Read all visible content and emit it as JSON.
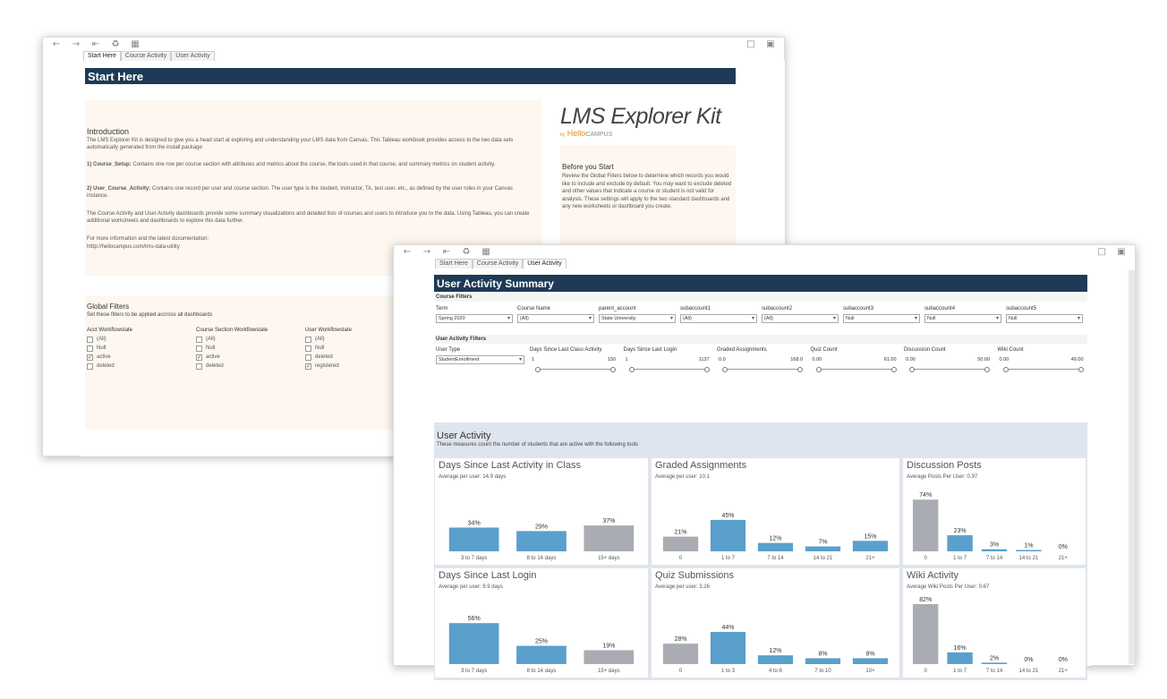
{
  "win1": {
    "tabs": [
      "Start Here",
      "Course Activity",
      "User Activity"
    ],
    "banner": "Start Here",
    "intro": {
      "heading": "Introduction",
      "p1": "The LMS Explorer Kit is designed to give you a head start at exploring and understanding your LMS data from Canvas.  This Tableau workbook provides access to the two data sets automatically generated from the install package:",
      "p2_bold": "1) Course_Setup:",
      "p2": " Contains one row per course section with attributes and metrics about the course, the tools used  in that course, and summary metrics on student activity.",
      "p3_bold": "2) User_Course_Activity:",
      "p3": " Contains one record per user and course section.  The user type is the student, instructor, TA, test user, etc., as defined by the user roles in your Canvas instance.",
      "p4": "The Course Activity and User Activity dashboards provide some summary visualizations and detailed lists of courses and users to introduce you to the data.  Using Tableau, you can create additional worksheets and dashboards to explore this data further.",
      "p5": "For more information and the latest documentation:",
      "p6": "htttp://heliocampus.com/lms-data-utility"
    },
    "logo": {
      "main": "LMS Explorer Kit",
      "by": "by",
      "brand_a": "Hello",
      "brand_b": "CAMPUS"
    },
    "before": {
      "heading": "Before you Start",
      "text": "Review the Global Filters below to determine which records you would like to include and exclude by default.  You may want to exclude deleted and other values that indicate a course or student is not valid for analysis.  These settings will apply to the two standard dashboards and any new worksheets or dashboard you create."
    },
    "global_filters": {
      "heading": "Global Filters",
      "sub": "Set these filters to be applied accross all dashboards",
      "groups": [
        {
          "title": "Acct Workflowstate",
          "items": [
            {
              "label": "(All)",
              "checked": false
            },
            {
              "label": "Null",
              "checked": false
            },
            {
              "label": "active",
              "checked": true
            },
            {
              "label": "deleted",
              "checked": false
            }
          ]
        },
        {
          "title": "Course Section Workflowstate",
          "items": [
            {
              "label": "(All)",
              "checked": false
            },
            {
              "label": "Null",
              "checked": false
            },
            {
              "label": "active",
              "checked": true
            },
            {
              "label": "deleted",
              "checked": false
            }
          ]
        },
        {
          "title": "User Workflowstate",
          "items": [
            {
              "label": "(All)",
              "checked": false
            },
            {
              "label": "Null",
              "checked": false
            },
            {
              "label": "deleted",
              "checked": false
            },
            {
              "label": "registered",
              "checked": true
            }
          ]
        }
      ]
    }
  },
  "win2": {
    "tabs": [
      "Start Here",
      "Course Activity",
      "User Activity"
    ],
    "banner": "User Activity Summary",
    "course_filters": {
      "label": "Course Filters",
      "fields": [
        {
          "label": "Term",
          "value": "Spring 2020"
        },
        {
          "label": "Course Name",
          "value": "(All)"
        },
        {
          "label": "parent_account",
          "value": "State University"
        },
        {
          "label": "subaccount1",
          "value": "(All)"
        },
        {
          "label": "subaccount2",
          "value": "(All)"
        },
        {
          "label": "subaccount3",
          "value": "Null"
        },
        {
          "label": "subaccount4",
          "value": "Null"
        },
        {
          "label": "subaccount5",
          "value": "Null"
        }
      ]
    },
    "user_filters": {
      "label": "User Activity Filters",
      "user_type": {
        "label": "User Type",
        "value": "StudentEnrollment"
      },
      "sliders": [
        {
          "label": "Days Since Last Class Activity",
          "min": "1",
          "max": "150"
        },
        {
          "label": "Days Since Last Login",
          "min": "1",
          "max": "1137"
        },
        {
          "label": "Graded Assignments",
          "min": "0.0",
          "max": "168.0"
        },
        {
          "label": "Quiz Count",
          "min": "0.00",
          "max": "61.00"
        },
        {
          "label": "Discussion Count",
          "min": "0.00",
          "max": "50.00"
        },
        {
          "label": "Wiki Count",
          "min": "0.00",
          "max": "49.00"
        }
      ]
    },
    "user_activity": {
      "heading": "User Activity",
      "sub": "These measures count the number of students that are active with the following tools"
    }
  },
  "chart_data": [
    {
      "type": "bar",
      "title": "Days Since Last Activity in Class",
      "subtitle": "Average per user: 14.9 days",
      "categories": [
        "3 to 7 days",
        "8 to 14 days",
        "15+ days"
      ],
      "values": [
        34,
        29,
        37
      ],
      "labels": [
        "34%",
        "29%",
        "37%"
      ],
      "colors": [
        "#5b9fcc",
        "#5b9fcc",
        "#a9adb3"
      ]
    },
    {
      "type": "bar",
      "title": "Graded Assignments",
      "subtitle": "Average per user: 10.1",
      "categories": [
        "0",
        "1 to 7",
        "7 to 14",
        "14 to 21",
        "21+"
      ],
      "values": [
        21,
        45,
        12,
        7,
        15
      ],
      "labels": [
        "21%",
        "45%",
        "12%",
        "7%",
        "15%"
      ],
      "colors": [
        "#a9adb3",
        "#5b9fcc",
        "#5b9fcc",
        "#5b9fcc",
        "#5b9fcc"
      ]
    },
    {
      "type": "bar",
      "title": "Discussion Posts",
      "subtitle": "Average Posts Per User: 0.97",
      "categories": [
        "0",
        "1 to 7",
        "7 to 14",
        "14 to 21",
        "21+"
      ],
      "values": [
        74,
        23,
        3,
        1,
        0
      ],
      "labels": [
        "74%",
        "23%",
        "3%",
        "1%",
        "0%"
      ],
      "colors": [
        "#a9adb3",
        "#5b9fcc",
        "#5b9fcc",
        "#5b9fcc",
        "#5b9fcc"
      ]
    },
    {
      "type": "bar",
      "title": "Days Since Last Login",
      "subtitle": "Average per user: 9.9 days",
      "categories": [
        "3 to 7 days",
        "8 to 14 days",
        "15+ days"
      ],
      "values": [
        56,
        25,
        19
      ],
      "labels": [
        "56%",
        "25%",
        "19%"
      ],
      "colors": [
        "#5b9fcc",
        "#5b9fcc",
        "#a9adb3"
      ]
    },
    {
      "type": "bar",
      "title": "Quiz Submissions",
      "subtitle": "Average per user: 3.26",
      "categories": [
        "0",
        "1 to 3",
        "4 to 6",
        "7 to 10",
        "10+"
      ],
      "values": [
        28,
        44,
        12,
        8,
        8
      ],
      "labels": [
        "28%",
        "44%",
        "12%",
        "8%",
        "8%"
      ],
      "colors": [
        "#a9adb3",
        "#5b9fcc",
        "#5b9fcc",
        "#5b9fcc",
        "#5b9fcc"
      ]
    },
    {
      "type": "bar",
      "title": "Wiki Activity",
      "subtitle": "Average Wiki Posts Per User: 0.67",
      "categories": [
        "0",
        "1 to 7",
        "7 to 14",
        "14 to 21",
        "21+"
      ],
      "values": [
        82,
        16,
        2,
        0,
        0
      ],
      "labels": [
        "82%",
        "16%",
        "2%",
        "0%",
        "0%"
      ],
      "colors": [
        "#a9adb3",
        "#5b9fcc",
        "#5b9fcc",
        "#5b9fcc",
        "#5b9fcc"
      ]
    }
  ]
}
